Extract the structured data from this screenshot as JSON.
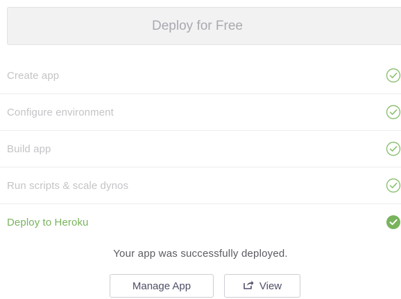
{
  "deploy_button": {
    "label": "Deploy for Free"
  },
  "steps": [
    {
      "label": "Create app",
      "status": "done",
      "icon": "check-circle-outline-icon"
    },
    {
      "label": "Configure environment",
      "status": "done",
      "icon": "check-circle-outline-icon"
    },
    {
      "label": "Build app",
      "status": "done",
      "icon": "check-circle-outline-icon"
    },
    {
      "label": "Run scripts & scale dynos",
      "status": "done",
      "icon": "check-circle-outline-icon"
    },
    {
      "label": "Deploy to Heroku",
      "status": "active",
      "icon": "check-circle-filled-icon"
    }
  ],
  "result": {
    "message": "Your app was successfully deployed.",
    "manage_label": "Manage App",
    "view_label": "View"
  },
  "colors": {
    "muted_text": "#c4c4c8",
    "success_green": "#79b35d",
    "check_outline": "#8cc071",
    "check_filled": "#79b35d",
    "button_text": "#4e4f66"
  }
}
